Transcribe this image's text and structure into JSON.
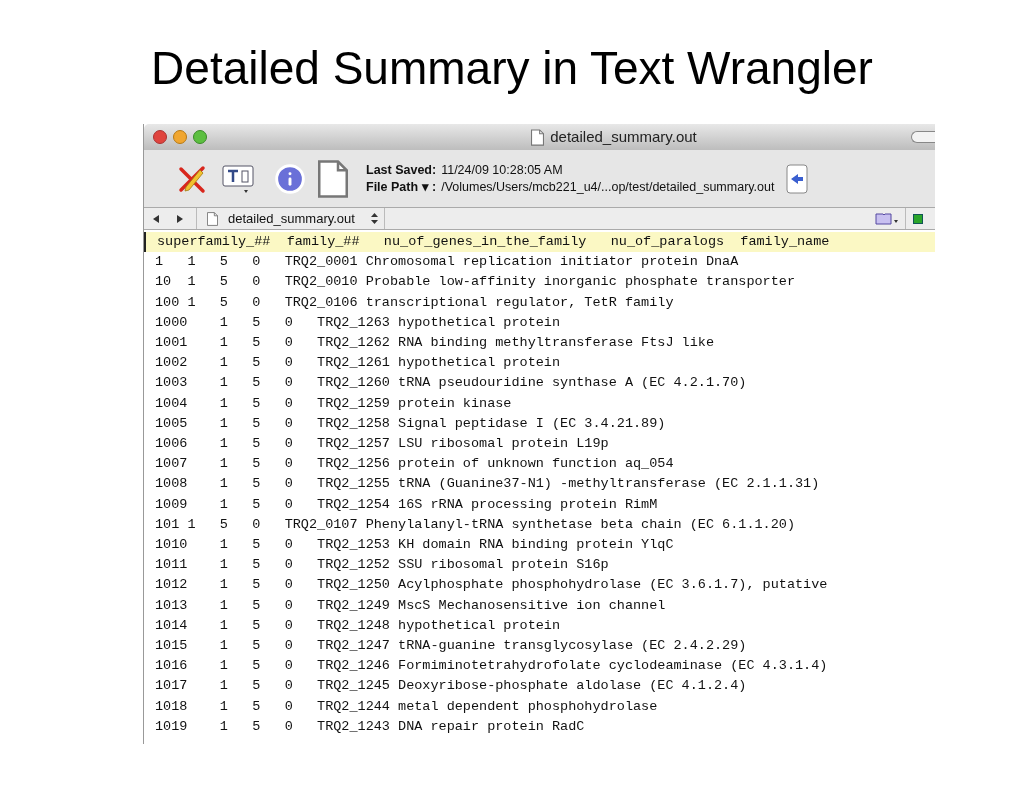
{
  "slide": {
    "title": "Detailed Summary in Text Wrangler"
  },
  "window": {
    "title": "detailed_summary.out"
  },
  "toolbar": {
    "last_saved_label": "Last Saved:",
    "last_saved": "11/24/09 10:28:05 AM",
    "file_path_label": "File Path ▾ :",
    "file_path": "/Volumes/Users/mcb221_u4/...op/test/detailed_summary.out"
  },
  "navbar": {
    "document": "detailed_summary.out"
  },
  "lines": [
    {
      "text": "superfamily_##\tfamily_##\tnu_of_genes_in_the_family\tnu_of_paralogs\tfamily_name",
      "highlighted": true
    },
    {
      "text": "1\t1\t5\t0\tTRQ2_0001 Chromosomal replication initiator protein DnaA",
      "highlighted": false
    },
    {
      "text": "10\t1\t5\t0\tTRQ2_0010 Probable low-affinity inorganic phosphate transporter",
      "highlighted": false
    },
    {
      "text": "100 1\t5\t0\tTRQ2_0106 transcriptional regulator, TetR family",
      "highlighted": false
    },
    {
      "text": "1000\t1\t5\t0\tTRQ2_1263 hypothetical protein",
      "highlighted": false
    },
    {
      "text": "1001\t1\t5\t0\tTRQ2_1262 RNA binding methyltransferase FtsJ like",
      "highlighted": false
    },
    {
      "text": "1002\t1\t5\t0\tTRQ2_1261 hypothetical protein",
      "highlighted": false
    },
    {
      "text": "1003\t1\t5\t0\tTRQ2_1260 tRNA pseudouridine synthase A (EC 4.2.1.70)",
      "highlighted": false
    },
    {
      "text": "1004\t1\t5\t0\tTRQ2_1259 protein kinase",
      "highlighted": false
    },
    {
      "text": "1005\t1\t5\t0\tTRQ2_1258 Signal peptidase I (EC 3.4.21.89)",
      "highlighted": false
    },
    {
      "text": "1006\t1\t5\t0\tTRQ2_1257 LSU ribosomal protein L19p",
      "highlighted": false
    },
    {
      "text": "1007\t1\t5\t0\tTRQ2_1256 protein of unknown function aq_054",
      "highlighted": false
    },
    {
      "text": "1008\t1\t5\t0\tTRQ2_1255 tRNA (Guanine37-N1) -methyltransferase (EC 2.1.1.31)",
      "highlighted": false
    },
    {
      "text": "1009\t1\t5\t0\tTRQ2_1254 16S rRNA processing protein RimM",
      "highlighted": false
    },
    {
      "text": "101 1\t5\t0\tTRQ2_0107 Phenylalanyl-tRNA synthetase beta chain (EC 6.1.1.20)",
      "highlighted": false
    },
    {
      "text": "1010\t1\t5\t0\tTRQ2_1253 KH domain RNA binding protein YlqC",
      "highlighted": false
    },
    {
      "text": "1011\t1\t5\t0\tTRQ2_1252 SSU ribosomal protein S16p",
      "highlighted": false
    },
    {
      "text": "1012\t1\t5\t0\tTRQ2_1250 Acylphosphate phosphohydrolase (EC 3.6.1.7), putative",
      "highlighted": false
    },
    {
      "text": "1013\t1\t5\t0\tTRQ2_1249 MscS Mechanosensitive ion channel",
      "highlighted": false
    },
    {
      "text": "1014\t1\t5\t0\tTRQ2_1248 hypothetical protein",
      "highlighted": false
    },
    {
      "text": "1015\t1\t5\t0\tTRQ2_1247 tRNA-guanine transglycosylase (EC 2.4.2.29)",
      "highlighted": false
    },
    {
      "text": "1016\t1\t5\t0\tTRQ2_1246 Formiminotetrahydrofolate cyclodeaminase (EC 4.3.1.4)",
      "highlighted": false
    },
    {
      "text": "1017\t1\t5\t0\tTRQ2_1245 Deoxyribose-phosphate aldolase (EC 4.1.2.4)",
      "highlighted": false
    },
    {
      "text": "1018\t1\t5\t0\tTRQ2_1244 metal dependent phosphohydrolase",
      "highlighted": false
    },
    {
      "text": "1019\t1\t5\t0\tTRQ2_1243 DNA repair protein RadC",
      "highlighted": false
    }
  ]
}
